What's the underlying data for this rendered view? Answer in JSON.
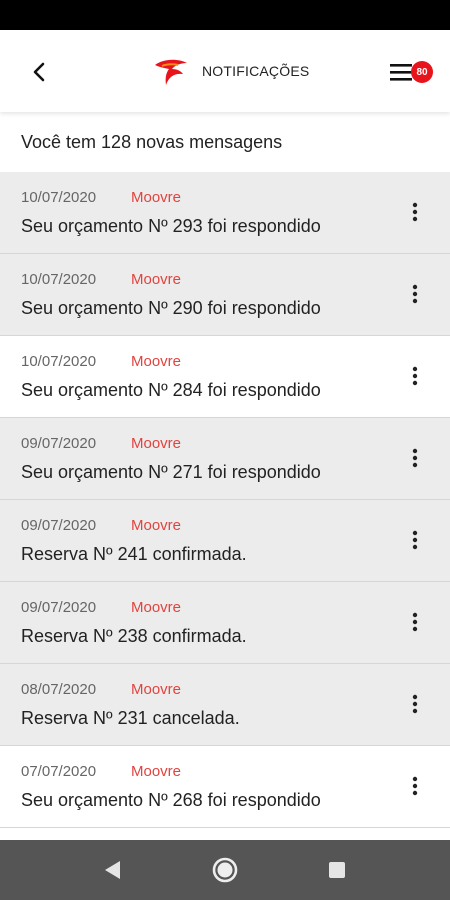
{
  "header": {
    "title": "NOTIFICAÇÕES",
    "badge_count": "80",
    "back_icon": "chevron-left-icon",
    "menu_icon": "hamburger-menu-icon",
    "logo_icon": "brand-logo-icon",
    "brand_color": "#e8141c"
  },
  "summary": {
    "text": "Você tem 128 novas mensagens"
  },
  "notifications": [
    {
      "date": "10/07/2020",
      "sender": "Moovre",
      "message": "Seu orçamento Nº 293 foi respondido",
      "unread": true
    },
    {
      "date": "10/07/2020",
      "sender": "Moovre",
      "message": "Seu orçamento Nº 290 foi respondido",
      "unread": true
    },
    {
      "date": "10/07/2020",
      "sender": "Moovre",
      "message": "Seu orçamento Nº 284 foi respondido",
      "unread": false
    },
    {
      "date": "09/07/2020",
      "sender": "Moovre",
      "message": "Seu orçamento Nº 271 foi respondido",
      "unread": true
    },
    {
      "date": "09/07/2020",
      "sender": "Moovre",
      "message": "Reserva Nº 241 confirmada.",
      "unread": true
    },
    {
      "date": "09/07/2020",
      "sender": "Moovre",
      "message": "Reserva Nº 238 confirmada.",
      "unread": true
    },
    {
      "date": "08/07/2020",
      "sender": "Moovre",
      "message": "Reserva Nº 231 cancelada.",
      "unread": true
    },
    {
      "date": "07/07/2020",
      "sender": "Moovre",
      "message": "Seu orçamento Nº 268 foi respondido",
      "unread": false
    }
  ],
  "item_more_icon": "more-vertical-icon",
  "nav": {
    "back_icon": "triangle-back-icon",
    "home_icon": "circle-home-icon",
    "recent_icon": "square-recents-icon"
  }
}
